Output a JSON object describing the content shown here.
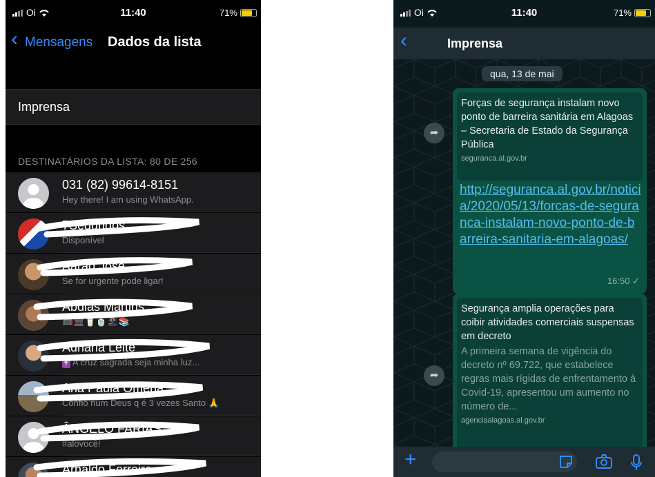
{
  "colors": {
    "ios_blue": "#2f8cff",
    "bubble_green": "#0a5244",
    "link_blue": "#53bdeb",
    "battery_yellow": "#f5d000"
  },
  "left": {
    "status": {
      "carrier": "Oi",
      "time": "11:40",
      "battery": "71%"
    },
    "nav": {
      "back_label": "Mensagens",
      "title": "Dados da lista"
    },
    "list_name": "Imprensa",
    "section_header": "DESTINATÁRIOS DA LISTA: 80 DE 256",
    "contacts": [
      {
        "name": "031 (82) 99614-8151",
        "status": "Hey there! I am using WhatsApp."
      },
      {
        "name": "7Segundos",
        "status": "Disponível"
      },
      {
        "name": "Aarão José",
        "status": "Se for urgente pode ligar!"
      },
      {
        "name": "Abdias Martins",
        "status": ""
      },
      {
        "name": "Adriana Leite",
        "status": "A cruz sagrada seja minha luz..."
      },
      {
        "name": "Ana Paula Omena",
        "status": "Confio num Deus q é 3 vezes Santo"
      },
      {
        "name": "ÂNGELO FARIAS",
        "status": "#alovocê!"
      },
      {
        "name": "Arnaldo Ferreira",
        "status": ""
      }
    ]
  },
  "right": {
    "status": {
      "carrier": "Oi",
      "time": "11:40",
      "battery": "71%"
    },
    "chat_title": "Imprensa",
    "date_chip": "qua, 13 de mai",
    "messages": [
      {
        "preview_title": "Forças de segurança instalam novo ponto de barreira sanitária em Alagoas – Secretaria de Estado da Segurança Pública",
        "preview_domain": "seguranca.al.gov.br",
        "link": "http://seguranca.al.gov.br/noticia/2020/05/13/forcas-de-seguranca-instalam-novo-ponto-de-barreira-sanitaria-em-alagoas/",
        "time": "16:50 ✓"
      },
      {
        "preview_title": "Segurança amplia operações para coibir atividades comerciais suspensas em decreto",
        "preview_desc": "A primeira semana de vigência do decreto nº 69.722, que estabelece regras mais rígidas de enfrentamento à Covid-19, apresentou um aumento no número de...",
        "preview_domain": "agenciaalagoas.al.gov.br"
      }
    ],
    "icons": [
      "plus-icon",
      "sticker-icon",
      "camera-icon",
      "mic-icon",
      "forward-icon",
      "back-chevron-icon"
    ]
  }
}
